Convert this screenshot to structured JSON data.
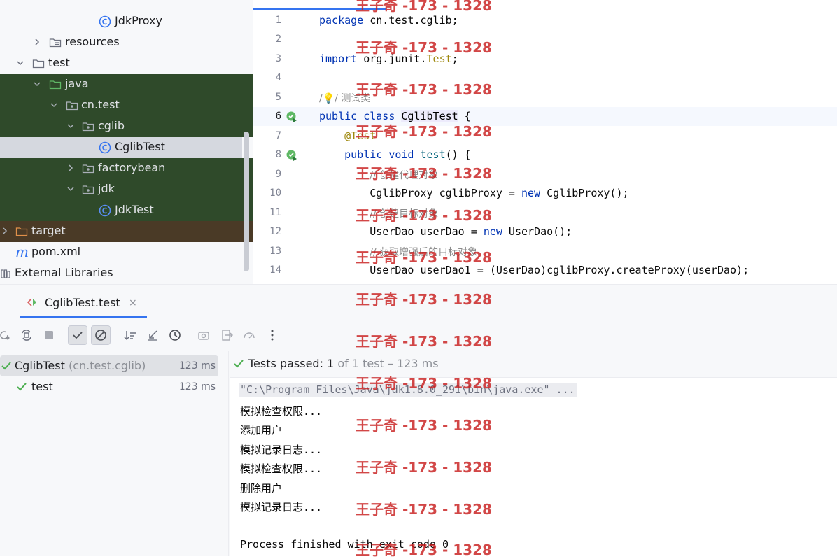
{
  "project_tree": {
    "items": [
      {
        "label": "JdkProxy",
        "icon": "java-class-icon"
      },
      {
        "label": "resources",
        "icon": "resources-folder-icon"
      },
      {
        "label": "test",
        "icon": "folder-icon"
      },
      {
        "label": "java",
        "icon": "test-sources-folder-icon"
      },
      {
        "label": "cn.test",
        "icon": "package-icon"
      },
      {
        "label": "cglib",
        "icon": "package-icon"
      },
      {
        "label": "CglibTest",
        "icon": "java-class-icon"
      },
      {
        "label": "factorybean",
        "icon": "package-icon"
      },
      {
        "label": "jdk",
        "icon": "package-icon"
      },
      {
        "label": "JdkTest",
        "icon": "java-class-icon"
      },
      {
        "label": "target",
        "icon": "excluded-folder-icon"
      },
      {
        "label": "pom.xml",
        "icon": "maven-icon"
      },
      {
        "label": "External Libraries",
        "icon": "libraries-icon"
      }
    ]
  },
  "editor": {
    "lines": [
      {
        "num": "1",
        "text": "package cn.test.cglib;"
      },
      {
        "num": "2",
        "text": ""
      },
      {
        "num": "3",
        "text": "import org.junit.Test;"
      },
      {
        "num": "4",
        "text": ""
      },
      {
        "num": "5",
        "text": "// 测试类"
      },
      {
        "num": "6",
        "text": "public class CglibTest {"
      },
      {
        "num": "7",
        "text": "    @Test"
      },
      {
        "num": "8",
        "text": "    public void test() {"
      },
      {
        "num": "9",
        "text": "        // 创建代理对象"
      },
      {
        "num": "10",
        "text": "        CglibProxy cglibProxy = new CglibProxy();"
      },
      {
        "num": "11",
        "text": "        // 创建目标对象"
      },
      {
        "num": "12",
        "text": "        UserDao userDao = new UserDao();"
      },
      {
        "num": "13",
        "text": "        // 获取增强后的目标对象"
      },
      {
        "num": "14",
        "text": "        UserDao userDao1 = (UserDao)cglibProxy.createProxy(userDao);"
      }
    ],
    "tokens": {
      "package_kw": "package",
      "package_name": " cn.test.cglib;",
      "import_kw": "import",
      "import_pkg": " org.junit.",
      "import_cls": "Test",
      "import_end": ";",
      "c5_pre": "/",
      "c5_text": "/ 测试类",
      "l6_public": "public",
      "l6_class": "class",
      "l6_name": "CglibTest",
      "l6_brace": " {",
      "l7_ann": "@Test",
      "l8_public": "public",
      "l8_void": "void",
      "l8_meth": "test",
      "l8_rest": "() {",
      "c9": "// 创建代理对象",
      "l10_a": "CglibProxy cglibProxy = ",
      "l10_new": "new",
      "l10_b": " CglibProxy();",
      "c11": "// 创建目标对象",
      "l12_a": "UserDao userDao = ",
      "l12_new": "new",
      "l12_b": " UserDao();",
      "c13": "// 获取增强后的目标对象",
      "l14": "UserDao userDao1 = (UserDao)cglibProxy.createProxy(userDao);"
    }
  },
  "run_window": {
    "tab_label": "CglibTest.test",
    "close_glyph": "×",
    "test_tree": [
      {
        "name": "CglibTest",
        "pkg": "(cn.test.cglib)",
        "time": "123 ms"
      },
      {
        "name": "test",
        "pkg": "",
        "time": "123 ms"
      }
    ],
    "status": {
      "prefix": "Tests passed: ",
      "count": "1",
      "suffix": " of 1 test – 123 ms"
    },
    "console": [
      "\"C:\\Program Files\\Java\\jdk1.8.0_291\\bin\\java.exe\" ...",
      "模拟检查权限...",
      "添加用户",
      "模拟记录日志...",
      "模拟检查权限...",
      "删除用户",
      "模拟记录日志...",
      "",
      "Process finished with exit code 0"
    ]
  },
  "watermark": "王子奇 -173 - 1328",
  "colors": {
    "accent": "#3574f0",
    "pass_green": "#4caf50",
    "test_src_bg": "#2f4a2a",
    "excluded_bg": "#4a3a26"
  }
}
